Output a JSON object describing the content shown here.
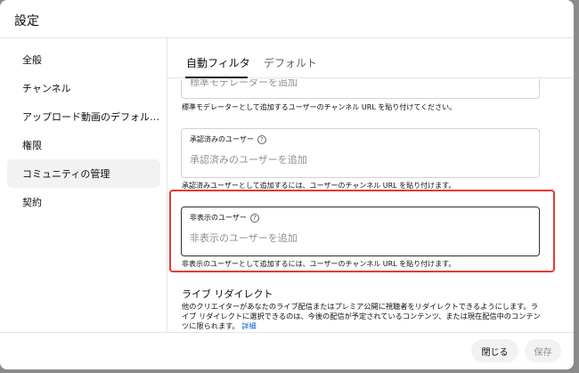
{
  "dialog": {
    "title": "設定"
  },
  "sidebar": {
    "items": [
      {
        "label": "全般"
      },
      {
        "label": "チャンネル"
      },
      {
        "label": "アップロード動画のデフォル…"
      },
      {
        "label": "権限"
      },
      {
        "label": "コミュニティの管理",
        "active": true
      },
      {
        "label": "契約"
      }
    ]
  },
  "tabs": [
    {
      "label": "自動フィルタ",
      "selected": true
    },
    {
      "label": "デフォルト"
    }
  ],
  "moderators": {
    "placeholder": "標準モデレーターを追加",
    "helper": "標準モデレーターとして追加するユーザーのチャンネル URL を貼り付けてください。"
  },
  "approved_users": {
    "label": "承認済みのユーザー",
    "placeholder": "承認済みのユーザーを追加",
    "helper": "承認済みユーザーとして追加するには、ユーザーのチャンネル URL を貼り付けます。"
  },
  "hidden_users": {
    "label": "非表示のユーザー",
    "placeholder": "非表示のユーザーを追加",
    "helper": "非表示のユーザーとして追加するには、ユーザーのチャンネル URL を貼り付けます。"
  },
  "live_redirect": {
    "title": "ライブ リダイレクト",
    "description": "他のクリエイターがあなたのライブ配信またはプレミア公開に視聴者をリダイレクトできるようにします。ライブ リダイレクトに選択できるのは、今後の配信が予定されているコンテンツ、または現在配信中のコンテンツに限られます。",
    "link": "詳細"
  },
  "footer": {
    "close_label": "閉じる",
    "save_label": "保存"
  },
  "colors": {
    "highlight": "#e53935",
    "link": "#065fd4"
  }
}
